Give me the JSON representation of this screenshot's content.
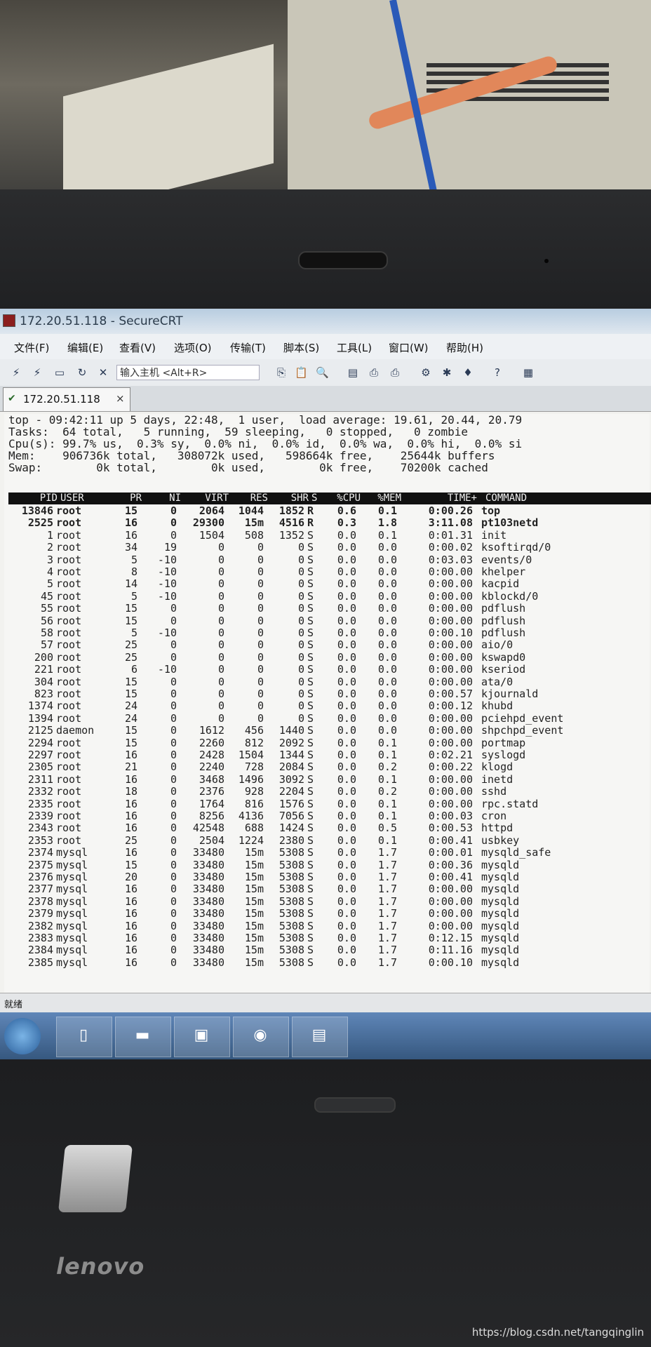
{
  "window": {
    "title": "172.20.51.118 - SecureCRT"
  },
  "menu": [
    "文件(F)",
    "编辑(E)",
    "查看(V)",
    "选项(O)",
    "传输(T)",
    "脚本(S)",
    "工具(L)",
    "窗口(W)",
    "帮助(H)"
  ],
  "toolbar": {
    "host_input_placeholder": "输入主机 <Alt+R>"
  },
  "tab": {
    "label": "172.20.51.118",
    "close": "×"
  },
  "top_header": [
    "top - 09:42:11 up 5 days, 22:48,  1 user,  load average: 19.61, 20.44, 20.79",
    "Tasks:  64 total,   5 running,  59 sleeping,   0 stopped,   0 zombie",
    "Cpu(s): 99.7% us,  0.3% sy,  0.0% ni,  0.0% id,  0.0% wa,  0.0% hi,  0.0% si",
    "Mem:    906736k total,   308072k used,   598664k free,    25644k buffers",
    "Swap:        0k total,        0k used,        0k free,    70200k cached"
  ],
  "columns": [
    "PID",
    "USER",
    "PR",
    "NI",
    "VIRT",
    "RES",
    "SHR",
    "S",
    "%CPU",
    "%MEM",
    "TIME+",
    "COMMAND"
  ],
  "processes": [
    [
      "13846",
      "root",
      "15",
      "0",
      "2064",
      "1044",
      "1852",
      "R",
      "0.6",
      "0.1",
      "0:00.26",
      "top"
    ],
    [
      "2525",
      "root",
      "16",
      "0",
      "29300",
      "15m",
      "4516",
      "R",
      "0.3",
      "1.8",
      "3:11.08",
      "pt103netd"
    ],
    [
      "1",
      "root",
      "16",
      "0",
      "1504",
      "508",
      "1352",
      "S",
      "0.0",
      "0.1",
      "0:01.31",
      "init"
    ],
    [
      "2",
      "root",
      "34",
      "19",
      "0",
      "0",
      "0",
      "S",
      "0.0",
      "0.0",
      "0:00.02",
      "ksoftirqd/0"
    ],
    [
      "3",
      "root",
      "5",
      "-10",
      "0",
      "0",
      "0",
      "S",
      "0.0",
      "0.0",
      "0:03.03",
      "events/0"
    ],
    [
      "4",
      "root",
      "8",
      "-10",
      "0",
      "0",
      "0",
      "S",
      "0.0",
      "0.0",
      "0:00.00",
      "khelper"
    ],
    [
      "5",
      "root",
      "14",
      "-10",
      "0",
      "0",
      "0",
      "S",
      "0.0",
      "0.0",
      "0:00.00",
      "kacpid"
    ],
    [
      "45",
      "root",
      "5",
      "-10",
      "0",
      "0",
      "0",
      "S",
      "0.0",
      "0.0",
      "0:00.00",
      "kblockd/0"
    ],
    [
      "55",
      "root",
      "15",
      "0",
      "0",
      "0",
      "0",
      "S",
      "0.0",
      "0.0",
      "0:00.00",
      "pdflush"
    ],
    [
      "56",
      "root",
      "15",
      "0",
      "0",
      "0",
      "0",
      "S",
      "0.0",
      "0.0",
      "0:00.00",
      "pdflush"
    ],
    [
      "58",
      "root",
      "5",
      "-10",
      "0",
      "0",
      "0",
      "S",
      "0.0",
      "0.0",
      "0:00.10",
      "pdflush"
    ],
    [
      "57",
      "root",
      "25",
      "0",
      "0",
      "0",
      "0",
      "S",
      "0.0",
      "0.0",
      "0:00.00",
      "aio/0"
    ],
    [
      "200",
      "root",
      "25",
      "0",
      "0",
      "0",
      "0",
      "S",
      "0.0",
      "0.0",
      "0:00.00",
      "kswapd0"
    ],
    [
      "221",
      "root",
      "6",
      "-10",
      "0",
      "0",
      "0",
      "S",
      "0.0",
      "0.0",
      "0:00.00",
      "kseriod"
    ],
    [
      "304",
      "root",
      "15",
      "0",
      "0",
      "0",
      "0",
      "S",
      "0.0",
      "0.0",
      "0:00.00",
      "ata/0"
    ],
    [
      "823",
      "root",
      "15",
      "0",
      "0",
      "0",
      "0",
      "S",
      "0.0",
      "0.0",
      "0:00.57",
      "kjournald"
    ],
    [
      "1374",
      "root",
      "24",
      "0",
      "0",
      "0",
      "0",
      "S",
      "0.0",
      "0.0",
      "0:00.12",
      "khubd"
    ],
    [
      "1394",
      "root",
      "24",
      "0",
      "0",
      "0",
      "0",
      "S",
      "0.0",
      "0.0",
      "0:00.00",
      "pciehpd_event"
    ],
    [
      "2125",
      "daemon",
      "15",
      "0",
      "1612",
      "456",
      "1440",
      "S",
      "0.0",
      "0.0",
      "0:00.00",
      "shpchpd_event"
    ],
    [
      "2294",
      "root",
      "15",
      "0",
      "2260",
      "812",
      "2092",
      "S",
      "0.0",
      "0.1",
      "0:00.00",
      "portmap"
    ],
    [
      "2297",
      "root",
      "16",
      "0",
      "2428",
      "1504",
      "1344",
      "S",
      "0.0",
      "0.1",
      "0:02.21",
      "syslogd"
    ],
    [
      "2305",
      "root",
      "21",
      "0",
      "2240",
      "728",
      "2084",
      "S",
      "0.0",
      "0.2",
      "0:00.22",
      "klogd"
    ],
    [
      "2311",
      "root",
      "16",
      "0",
      "3468",
      "1496",
      "3092",
      "S",
      "0.0",
      "0.1",
      "0:00.00",
      "inetd"
    ],
    [
      "2332",
      "root",
      "18",
      "0",
      "2376",
      "928",
      "2204",
      "S",
      "0.0",
      "0.2",
      "0:00.00",
      "sshd"
    ],
    [
      "2335",
      "root",
      "16",
      "0",
      "1764",
      "816",
      "1576",
      "S",
      "0.0",
      "0.1",
      "0:00.00",
      "rpc.statd"
    ],
    [
      "2339",
      "root",
      "16",
      "0",
      "8256",
      "4136",
      "7056",
      "S",
      "0.0",
      "0.1",
      "0:00.03",
      "cron"
    ],
    [
      "2343",
      "root",
      "16",
      "0",
      "42548",
      "688",
      "1424",
      "S",
      "0.0",
      "0.5",
      "0:00.53",
      "httpd"
    ],
    [
      "2353",
      "root",
      "25",
      "0",
      "2504",
      "1224",
      "2380",
      "S",
      "0.0",
      "0.1",
      "0:00.41",
      "usbkey"
    ],
    [
      "2374",
      "mysql",
      "16",
      "0",
      "33480",
      "15m",
      "5308",
      "S",
      "0.0",
      "1.7",
      "0:00.01",
      "mysqld_safe"
    ],
    [
      "2375",
      "mysql",
      "15",
      "0",
      "33480",
      "15m",
      "5308",
      "S",
      "0.0",
      "1.7",
      "0:00.36",
      "mysqld"
    ],
    [
      "2376",
      "mysql",
      "20",
      "0",
      "33480",
      "15m",
      "5308",
      "S",
      "0.0",
      "1.7",
      "0:00.41",
      "mysqld"
    ],
    [
      "2377",
      "mysql",
      "16",
      "0",
      "33480",
      "15m",
      "5308",
      "S",
      "0.0",
      "1.7",
      "0:00.00",
      "mysqld"
    ],
    [
      "2378",
      "mysql",
      "16",
      "0",
      "33480",
      "15m",
      "5308",
      "S",
      "0.0",
      "1.7",
      "0:00.00",
      "mysqld"
    ],
    [
      "2379",
      "mysql",
      "16",
      "0",
      "33480",
      "15m",
      "5308",
      "S",
      "0.0",
      "1.7",
      "0:00.00",
      "mysqld"
    ],
    [
      "2382",
      "mysql",
      "16",
      "0",
      "33480",
      "15m",
      "5308",
      "S",
      "0.0",
      "1.7",
      "0:00.00",
      "mysqld"
    ],
    [
      "2383",
      "mysql",
      "16",
      "0",
      "33480",
      "15m",
      "5308",
      "S",
      "0.0",
      "1.7",
      "0:12.15",
      "mysqld"
    ],
    [
      "2384",
      "mysql",
      "16",
      "0",
      "33480",
      "15m",
      "5308",
      "S",
      "0.0",
      "1.7",
      "0:11.16",
      "mysqld"
    ],
    [
      "2385",
      "mysql",
      "16",
      "0",
      "33480",
      "15m",
      "5308",
      "S",
      "0.0",
      "1.7",
      "0:00.10",
      "mysqld"
    ]
  ],
  "status": {
    "text": "就绪"
  },
  "laptop": {
    "brand": "lenovo"
  },
  "watermark": "https://blog.csdn.net/tangqinglin"
}
